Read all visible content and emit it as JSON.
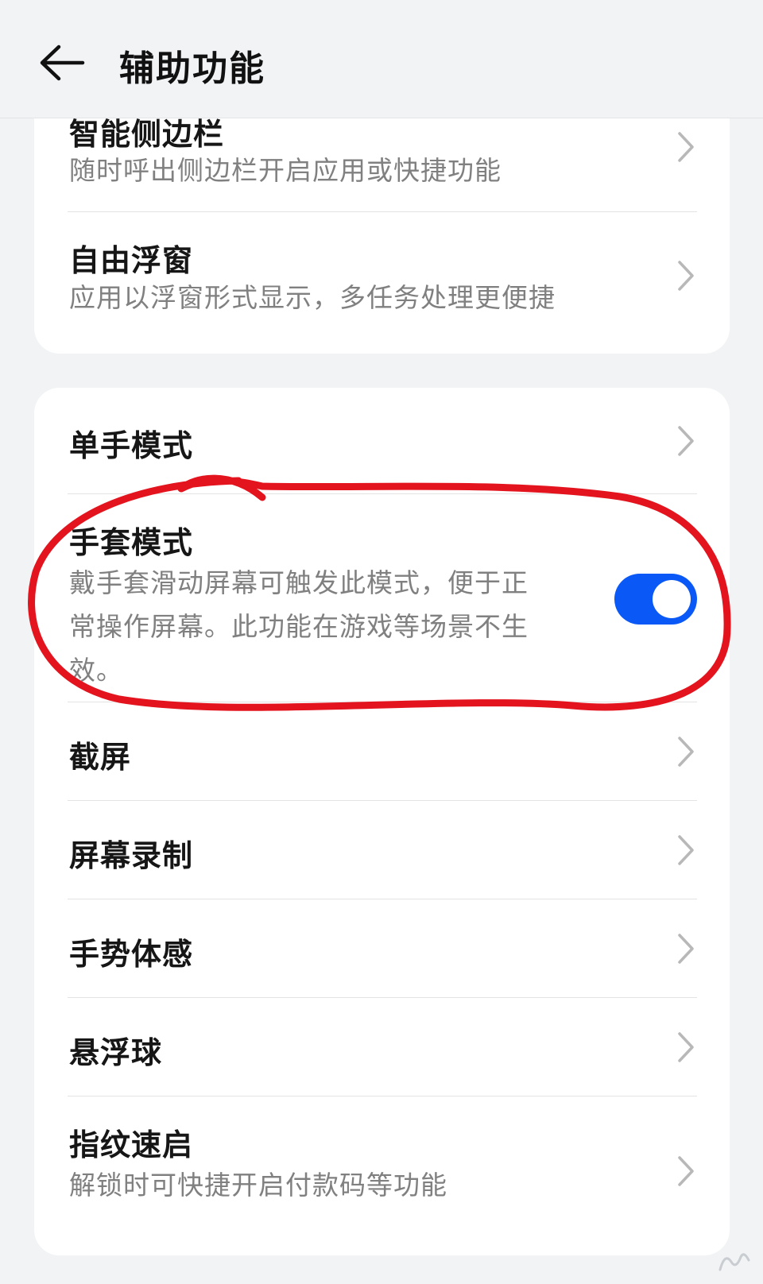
{
  "header": {
    "title": "辅助功能",
    "back_icon": "arrow-left-icon"
  },
  "card1": {
    "items": [
      {
        "title": "智能侧边栏",
        "subtitle": "随时呼出侧边栏开启应用或快捷功能"
      },
      {
        "title": "自由浮窗",
        "subtitle": "应用以浮窗形式显示，多任务处理更便捷"
      }
    ]
  },
  "card2": {
    "items": [
      {
        "title": "单手模式"
      },
      {
        "title": "手套模式",
        "subtitle_lines": [
          "戴手套滑动屏幕可触发此模式，便于正",
          "常操作屏幕。此功能在游戏等场景不生",
          "效。"
        ],
        "toggle_on": true
      },
      {
        "title": "截屏"
      },
      {
        "title": "屏幕录制"
      },
      {
        "title": "手势体感"
      },
      {
        "title": "悬浮球"
      },
      {
        "title": "指纹速启",
        "subtitle": "解锁时可快捷开启付款码等功能"
      }
    ]
  },
  "colors": {
    "background": "#f1f3f5",
    "card": "#ffffff",
    "toggle_on": "#0a59f7",
    "annotation": "#e3141e",
    "subtitle_text": "#808080"
  },
  "icons": {
    "chevron": "chevron-right-icon",
    "annotation": "hand-drawn-circle"
  }
}
